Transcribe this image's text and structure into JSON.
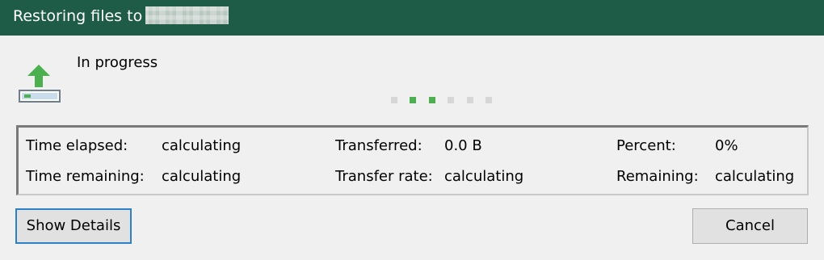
{
  "window": {
    "title": "Restoring files to"
  },
  "status": {
    "text": "In progress",
    "icon": "restore-upload-icon",
    "spinner_dots": 6,
    "spinner_active": [
      1,
      2
    ]
  },
  "stats": {
    "time_elapsed_label": "Time elapsed:",
    "time_elapsed_value": "calculating",
    "time_remaining_label": "Time remaining:",
    "time_remaining_value": "calculating",
    "transferred_label": "Transferred:",
    "transferred_value": "0.0 B",
    "transfer_rate_label": "Transfer rate:",
    "transfer_rate_value": "calculating",
    "percent_label": "Percent:",
    "percent_value": "0%",
    "remaining_label": "Remaining:",
    "remaining_value": "calculating"
  },
  "buttons": {
    "show_details": "Show Details",
    "cancel": "Cancel"
  },
  "colors": {
    "titlebar": "#1e5c48",
    "accent_green": "#4caf50",
    "focus_border": "#2d7fc7",
    "background": "#f0f0f0"
  }
}
